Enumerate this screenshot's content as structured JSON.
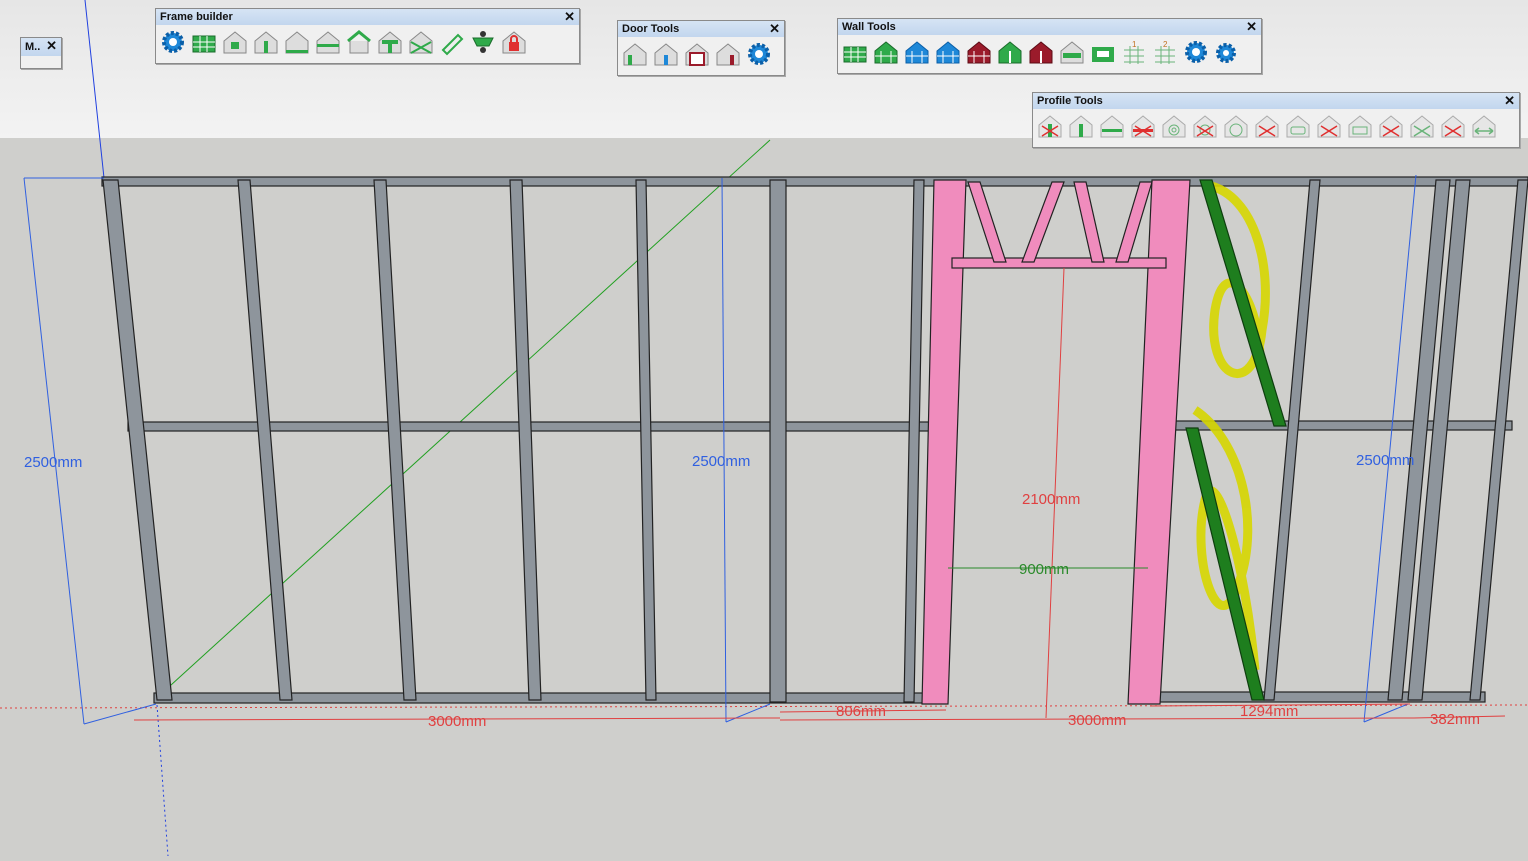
{
  "toolbars": {
    "mini": {
      "title": "M.."
    },
    "frame_builder": {
      "title": "Frame builder"
    },
    "door_tools": {
      "title": "Door Tools"
    },
    "wall_tools": {
      "title": "Wall Tools"
    },
    "profile_tools": {
      "title": "Profile Tools"
    }
  },
  "close_glyph": "✕",
  "dimensions": {
    "left_height": "2500mm",
    "mid_height": "2500mm",
    "right_height": "2500mm",
    "door_height": "2100mm",
    "door_width": "900mm",
    "wall1_length": "3000mm",
    "wall2_length": "3000mm",
    "offset_806": "806mm",
    "offset_1294": "1294mm",
    "offset_382": "382mm"
  },
  "colors": {
    "sky": "#e9e9e9",
    "ground": "#cfcfcc",
    "stud": "#8e959c",
    "door_frame": "#f08cbd",
    "brace": "#1e7e1e",
    "highlight": "#d6d600",
    "dim_blue": "#3060e0",
    "dim_red": "#e04040",
    "dim_green": "#2a8a2a"
  }
}
